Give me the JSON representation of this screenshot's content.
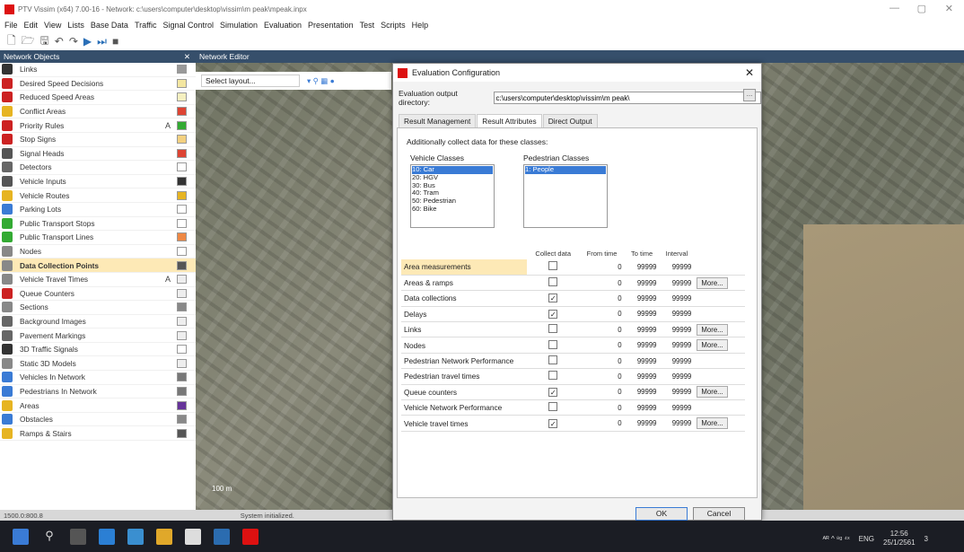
{
  "window": {
    "title": "PTV Vissim (x64) 7.00-16 - Network: c:\\users\\computer\\desktop\\vissim\\m peak\\mpeak.inpx"
  },
  "menu": [
    "File",
    "Edit",
    "View",
    "Lists",
    "Base Data",
    "Traffic",
    "Signal Control",
    "Simulation",
    "Evaluation",
    "Presentation",
    "Test",
    "Scripts",
    "Help"
  ],
  "panels": {
    "network_objects": "Network Objects",
    "network_editor": "Network Editor",
    "select_layout": "Select layout..."
  },
  "network_objects": [
    {
      "label": "Links",
      "color": "#333",
      "swatch": "#999"
    },
    {
      "label": "Desired Speed Decisions",
      "color": "#c22",
      "swatch": "#f3e6a0"
    },
    {
      "label": "Reduced Speed Areas",
      "color": "#c22",
      "swatch": "#f5f0c0"
    },
    {
      "label": "Conflict Areas",
      "color": "#e6b422",
      "swatch": "#d43"
    },
    {
      "label": "Priority Rules",
      "color": "#c22",
      "swatch": "#3a3",
      "alpha": "A"
    },
    {
      "label": "Stop Signs",
      "color": "#c22",
      "swatch": "#f3d080"
    },
    {
      "label": "Signal Heads",
      "color": "#555",
      "swatch": "#d43"
    },
    {
      "label": "Detectors",
      "color": "#666",
      "swatch": "#fff"
    },
    {
      "label": "Vehicle Inputs",
      "color": "#555",
      "swatch": "#333"
    },
    {
      "label": "Vehicle Routes",
      "color": "#e6b422",
      "swatch": "#e6b422"
    },
    {
      "label": "Parking Lots",
      "color": "#3a7bd5",
      "swatch": "#fff"
    },
    {
      "label": "Public Transport Stops",
      "color": "#3a3",
      "swatch": "#fff"
    },
    {
      "label": "Public Transport Lines",
      "color": "#3a3",
      "swatch": "#e84"
    },
    {
      "label": "Nodes",
      "color": "#888",
      "swatch": "#fff"
    },
    {
      "label": "Data Collection Points",
      "color": "#888",
      "swatch": "#555"
    },
    {
      "label": "Vehicle Travel Times",
      "color": "#888",
      "swatch": "#eee",
      "alpha": "A"
    },
    {
      "label": "Queue Counters",
      "color": "#c22",
      "swatch": "#eee"
    },
    {
      "label": "Sections",
      "color": "#888",
      "swatch": "#888"
    },
    {
      "label": "Background Images",
      "color": "#666",
      "swatch": "#eee"
    },
    {
      "label": "Pavement Markings",
      "color": "#666",
      "swatch": "#eee"
    },
    {
      "label": "3D Traffic Signals",
      "color": "#333",
      "swatch": "#fff"
    },
    {
      "label": "Static 3D Models",
      "color": "#888",
      "swatch": "#eee"
    },
    {
      "label": "Vehicles In Network",
      "color": "#3a7bd5",
      "swatch": "#777"
    },
    {
      "label": "Pedestrians In Network",
      "color": "#3a7bd5",
      "swatch": "#777"
    },
    {
      "label": "Areas",
      "color": "#e6b422",
      "swatch": "#639"
    },
    {
      "label": "Obstacles",
      "color": "#3a7bd5",
      "swatch": "#888"
    },
    {
      "label": "Ramps & Stairs",
      "color": "#e6b422",
      "swatch": "#555"
    }
  ],
  "selected_object": "Data Collection Points",
  "statusbar": {
    "coords": "1500.0:800.8",
    "status": "System initialized."
  },
  "dialog": {
    "title": "Evaluation Configuration",
    "output_dir_label": "Evaluation output directory:",
    "output_dir_value": "c:\\users\\computer\\desktop\\vissim\\m peak\\",
    "tabs": [
      "Result Management",
      "Result Attributes",
      "Direct Output"
    ],
    "active_tab": "Result Attributes",
    "collect_label": "Additionally collect data for these classes:",
    "vehicle_classes_label": "Vehicle Classes",
    "vehicle_classes": [
      "10: Car",
      "20: HGV",
      "30: Bus",
      "40: Tram",
      "50: Pedestrian",
      "60: Bike"
    ],
    "pedestrian_classes_label": "Pedestrian Classes",
    "pedestrian_classes": [
      "1: People"
    ],
    "columns": [
      "Collect data",
      "From time",
      "To time",
      "Interval"
    ],
    "rows": [
      {
        "name": "Area measurements",
        "collect": false,
        "from": "0",
        "to": "99999",
        "interval": "99999",
        "more": ""
      },
      {
        "name": "Areas & ramps",
        "collect": false,
        "from": "0",
        "to": "99999",
        "interval": "99999",
        "more": "More..."
      },
      {
        "name": "Data collections",
        "collect": true,
        "from": "0",
        "to": "99999",
        "interval": "99999",
        "more": ""
      },
      {
        "name": "Delays",
        "collect": true,
        "from": "0",
        "to": "99999",
        "interval": "99999",
        "more": ""
      },
      {
        "name": "Links",
        "collect": false,
        "from": "0",
        "to": "99999",
        "interval": "99999",
        "more": "More..."
      },
      {
        "name": "Nodes",
        "collect": false,
        "from": "0",
        "to": "99999",
        "interval": "99999",
        "more": "More..."
      },
      {
        "name": "Pedestrian Network Performance",
        "collect": false,
        "from": "0",
        "to": "99999",
        "interval": "99999",
        "more": ""
      },
      {
        "name": "Pedestrian travel times",
        "collect": false,
        "from": "0",
        "to": "99999",
        "interval": "99999",
        "more": ""
      },
      {
        "name": "Queue counters",
        "collect": true,
        "from": "0",
        "to": "99999",
        "interval": "99999",
        "more": "More..."
      },
      {
        "name": "Vehicle Network Performance",
        "collect": false,
        "from": "0",
        "to": "99999",
        "interval": "99999",
        "more": ""
      },
      {
        "name": "Vehicle travel times",
        "collect": true,
        "from": "0",
        "to": "99999",
        "interval": "99999",
        "more": "More..."
      }
    ],
    "ok": "OK",
    "cancel": "Cancel"
  },
  "map": {
    "scale": "100 m"
  },
  "taskbar": {
    "lang": "ENG",
    "time": "12:56",
    "date": "25/1/2561",
    "tray": "ᴬᴿ ^ ⁸ᵍ ⁴ˣ",
    "notif": "3"
  }
}
